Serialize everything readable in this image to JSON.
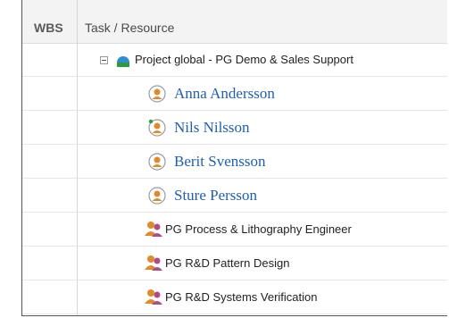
{
  "header": {
    "wbs": "WBS",
    "task_resource": "Task / Resource"
  },
  "project": {
    "name": "Project global - PG Demo & Sales Support"
  },
  "resources": [
    {
      "name": "Anna Andersson"
    },
    {
      "name": "Nils Nilsson"
    },
    {
      "name": "Berit Svensson"
    },
    {
      "name": "Sture Persson"
    }
  ],
  "roles": [
    {
      "name": "PG Process & Lithography Engineer"
    },
    {
      "name": "PG R&D Pattern Design"
    },
    {
      "name": "PG R&D Systems Verification"
    }
  ],
  "colors": {
    "link": "#1f5fb0",
    "project_icon": "#2a8fd6",
    "person_icon": "#e08a2a"
  }
}
